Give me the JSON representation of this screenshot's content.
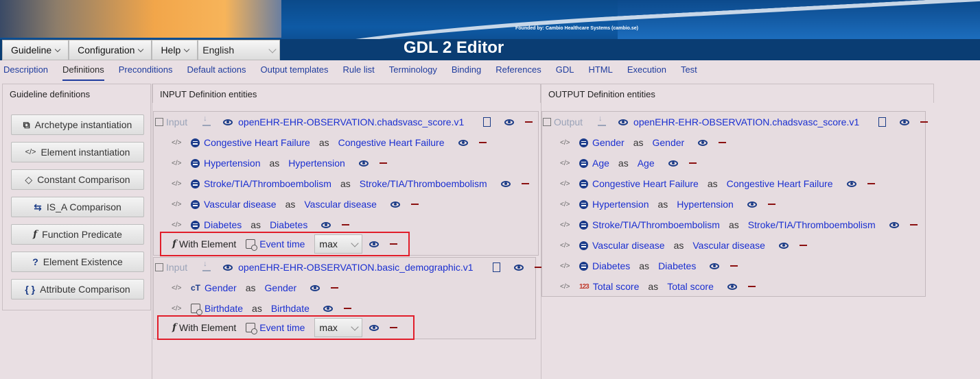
{
  "header": {
    "founded": "Founded by: Cambio Healthcare Systems (cambio.se)",
    "title": "GDL 2 Editor"
  },
  "menu": {
    "guideline": "Guideline",
    "configuration": "Configuration",
    "help": "Help",
    "language": "English"
  },
  "tabs": [
    "Description",
    "Definitions",
    "Preconditions",
    "Default actions",
    "Output templates",
    "Rule list",
    "Terminology",
    "Binding",
    "References",
    "GDL",
    "HTML",
    "Execution",
    "Test"
  ],
  "sidebar": {
    "title": "Guideline definitions",
    "items": [
      {
        "label": "Archetype instantiation",
        "icon": "archetype-icon"
      },
      {
        "label": "Element instantiation",
        "icon": "code-icon"
      },
      {
        "label": "Constant Comparison",
        "icon": "diamond-icon"
      },
      {
        "label": "IS_A Comparison",
        "icon": "arrows-icon"
      },
      {
        "label": "Function Predicate",
        "icon": "function-icon"
      },
      {
        "label": "Element Existence",
        "icon": "question-icon"
      },
      {
        "label": "Attribute Comparison",
        "icon": "braces-icon"
      }
    ]
  },
  "input": {
    "title": "INPUT Definition entities",
    "label": "Input",
    "blocks": [
      {
        "archetype": "openEHR-EHR-OBSERVATION.chadsvasc_score.v1",
        "elements": [
          {
            "name": "Congestive Heart Failure",
            "as": "as",
            "alias": "Congestive Heart Failure"
          },
          {
            "name": "Hypertension",
            "as": "as",
            "alias": "Hypertension"
          },
          {
            "name": "Stroke/TIA/Thromboembolism",
            "as": "as",
            "alias": "Stroke/TIA/Thromboembolism"
          },
          {
            "name": "Vascular disease",
            "as": "as",
            "alias": "Vascular disease"
          },
          {
            "name": "Diabetes",
            "as": "as",
            "alias": "Diabetes"
          }
        ],
        "with_element": {
          "label": "With Element",
          "element": "Event time",
          "func": "max"
        }
      },
      {
        "archetype": "openEHR-EHR-OBSERVATION.basic_demographic.v1",
        "elements": [
          {
            "name": "Gender",
            "as": "as",
            "alias": "Gender"
          },
          {
            "name": "Birthdate",
            "as": "as",
            "alias": "Birthdate"
          }
        ],
        "with_element": {
          "label": "With Element",
          "element": "Event time",
          "func": "max"
        }
      }
    ]
  },
  "output": {
    "title": "OUTPUT Definition entities",
    "label": "Output",
    "archetype": "openEHR-EHR-OBSERVATION.chadsvasc_score.v1",
    "elements": [
      {
        "name": "Gender",
        "as": "as",
        "alias": "Gender"
      },
      {
        "name": "Age",
        "as": "as",
        "alias": "Age"
      },
      {
        "name": "Congestive Heart Failure",
        "as": "as",
        "alias": "Congestive Heart Failure"
      },
      {
        "name": "Hypertension",
        "as": "as",
        "alias": "Hypertension"
      },
      {
        "name": "Stroke/TIA/Thromboembolism",
        "as": "as",
        "alias": "Stroke/TIA/Thromboembolism"
      },
      {
        "name": "Vascular disease",
        "as": "as",
        "alias": "Vascular disease"
      },
      {
        "name": "Diabetes",
        "as": "as",
        "alias": "Diabetes"
      },
      {
        "name": "Total score",
        "as": "as",
        "alias": "Total score"
      }
    ]
  },
  "icons": {
    "code": "</>",
    "function": "f",
    "number_icon": "123"
  }
}
